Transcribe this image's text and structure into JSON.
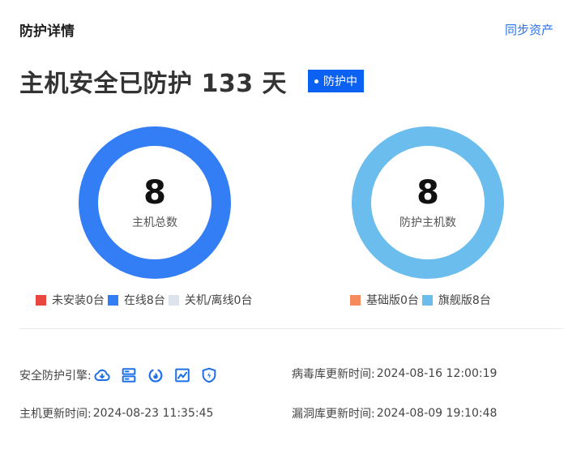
{
  "header": {
    "title": "防护详情",
    "sync_link": "同步资产"
  },
  "headline": {
    "text": "主机安全已防护 133 天",
    "status_badge": "防护中"
  },
  "donuts": {
    "left": {
      "value": "8",
      "label": "主机总数",
      "color": "#347ef5"
    },
    "right": {
      "value": "8",
      "label": "防护主机数",
      "color": "#6bbdee"
    }
  },
  "legend_left": [
    {
      "label": "未安装0台",
      "color": "#e8463e"
    },
    {
      "label": "在线8台",
      "color": "#347ef5"
    },
    {
      "label": "关机/离线0台",
      "color": "#dde3ea"
    }
  ],
  "legend_right": [
    {
      "label": "基础版0台",
      "color": "#f58a5c"
    },
    {
      "label": "旗舰版8台",
      "color": "#6bbdee"
    }
  ],
  "info": {
    "engines_label": "安全防护引擎:",
    "engine_icons": [
      "cloud-icon",
      "server-icon",
      "flame-icon",
      "monitor-chart-icon",
      "shield-icon"
    ],
    "engine_icon_color": "#1f6fe8",
    "host_update_label": "主机更新时间:",
    "host_update_value": "2024-08-23 11:35:45",
    "virus_update_label": "病毒库更新时间:",
    "virus_update_value": "2024-08-16 12:00:19",
    "vuln_update_label": "漏洞库更新时间:",
    "vuln_update_value": "2024-08-09 19:10:48"
  }
}
